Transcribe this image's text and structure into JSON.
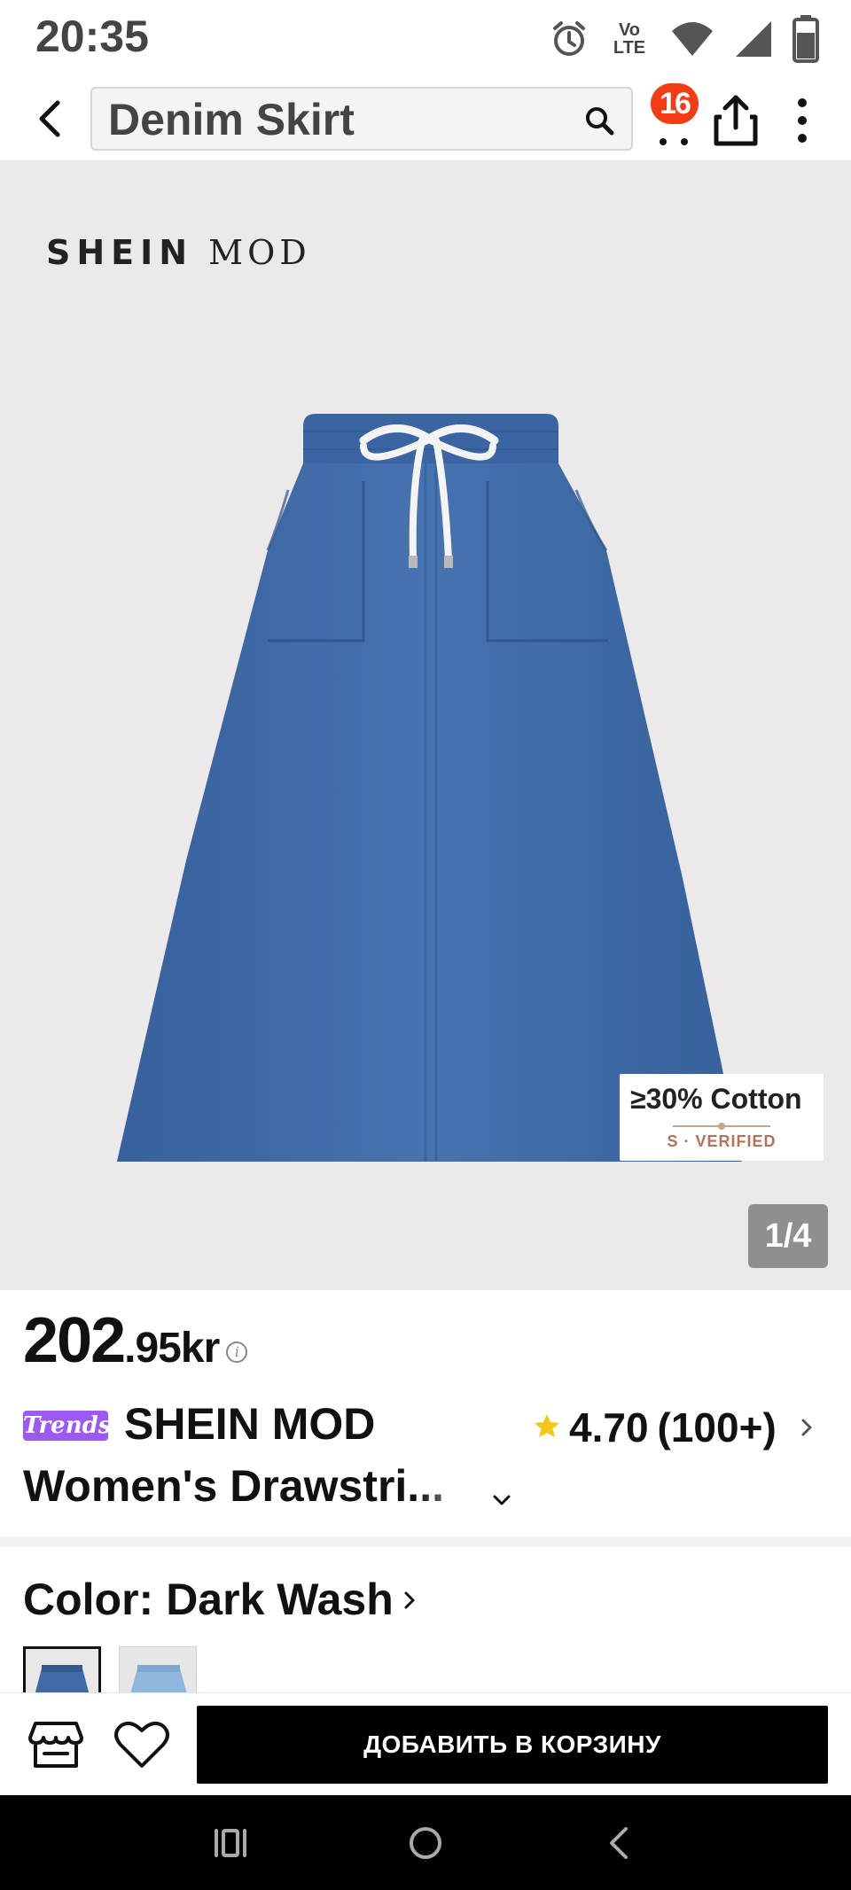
{
  "status_bar": {
    "time": "20:35",
    "network_label_top": "Vo",
    "network_label_bottom": "LTE",
    "icons": [
      "alarm-icon",
      "volte-icon",
      "wifi-icon",
      "signal-icon",
      "battery-icon"
    ]
  },
  "nav": {
    "search_value": "Denim Skirt",
    "cart_count": "16",
    "icons": [
      "back-arrow-icon",
      "search-icon",
      "cart-icon",
      "share-icon",
      "more-vertical-icon"
    ]
  },
  "gallery": {
    "brand_logo_bold": "SHEIN",
    "brand_logo_light": "MOD",
    "cotton_badge": "≥30% Cotton",
    "verified_label": "S · VERIFIED",
    "page_indicator": "1/4",
    "accent_colors": {
      "denim": "#3f6aa6",
      "background": "#ebe9ea"
    }
  },
  "product": {
    "price_int": "202",
    "price_dec": ".95kr",
    "trends_badge": "Trends",
    "title_line1": "SHEIN MOD",
    "title_line2": "Women's Drawstri...",
    "rating_value": "4.70",
    "rating_count": "(100+)",
    "rating_star_color": "#f5c518"
  },
  "color": {
    "label": "Color:",
    "value": "Dark Wash",
    "swatches": [
      "dark-wash",
      "light-wash"
    ]
  },
  "action_bar": {
    "add_to_cart_label": "ДОБАВИТЬ В КОРЗИНУ",
    "icons": [
      "store-icon",
      "heart-icon"
    ]
  },
  "system_nav": {
    "icons": [
      "recent-apps-icon",
      "home-icon",
      "system-back-icon"
    ]
  }
}
